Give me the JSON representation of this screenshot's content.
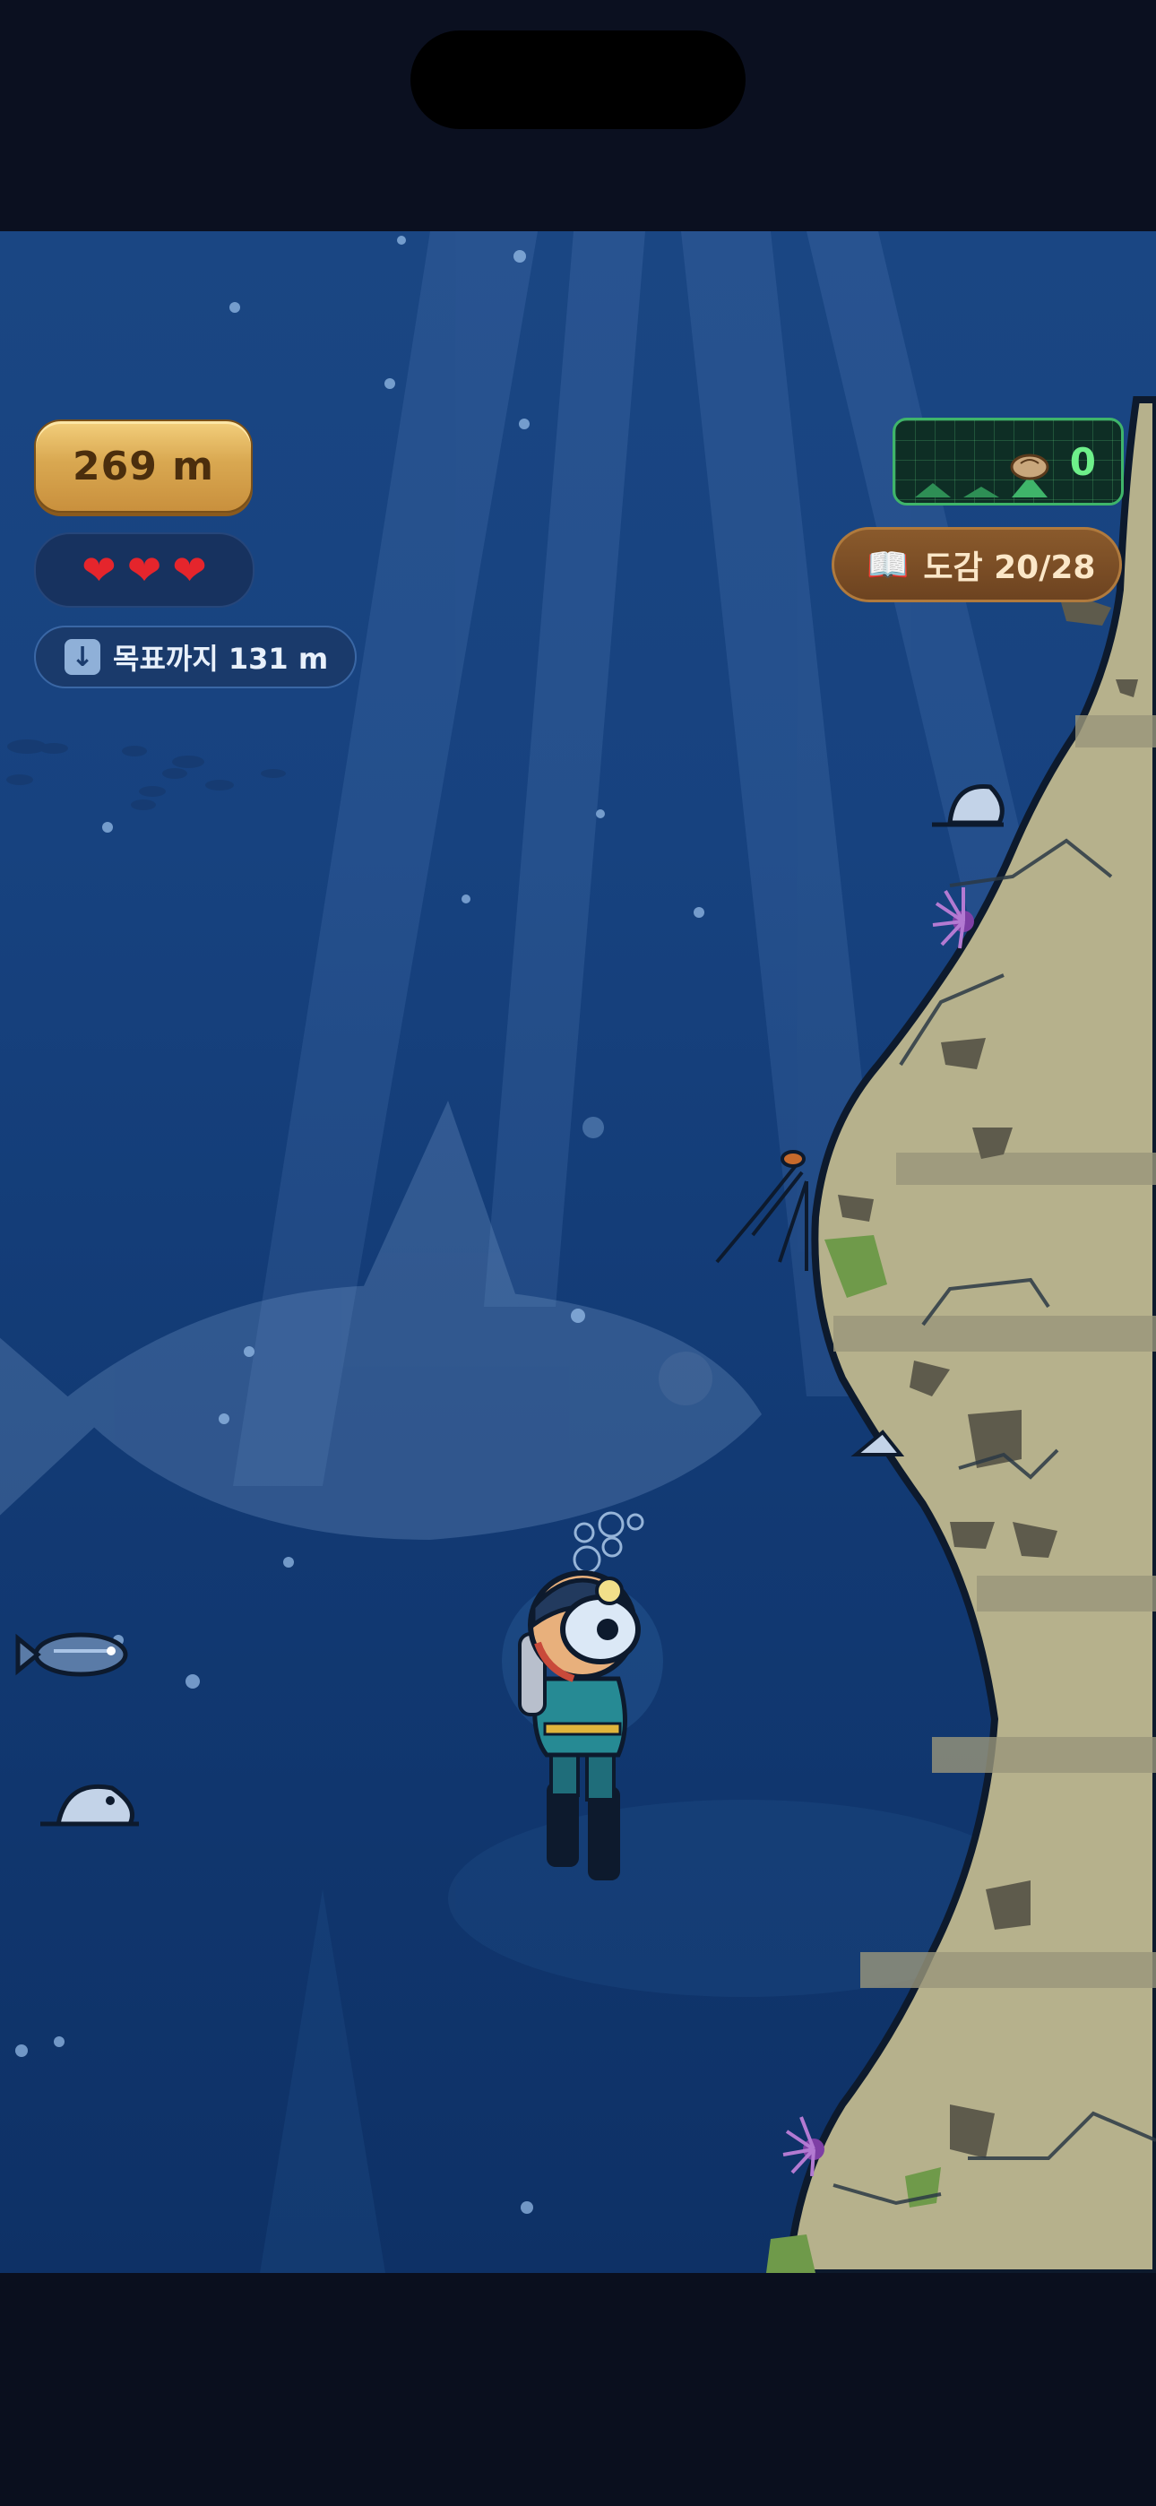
{
  "hud": {
    "depth_label": "269 m",
    "lives": {
      "current": 3,
      "max": 3,
      "symbols": [
        "❤",
        "❤",
        "❤"
      ]
    },
    "target_label": "목표까지 131 m",
    "target_icon": "down-arrow-icon",
    "radar_count": "0",
    "radar_icon": "shell-icon",
    "codex_label": "도감 20/28",
    "codex_icon": "book-icon"
  },
  "colors": {
    "water_top": "#1a4683",
    "water_bottom": "#0e3166",
    "depth_plate": "#d9a851",
    "radar_green": "#6ef08a",
    "codex_brown": "#6d4320",
    "heart_red": "#e5252c"
  }
}
